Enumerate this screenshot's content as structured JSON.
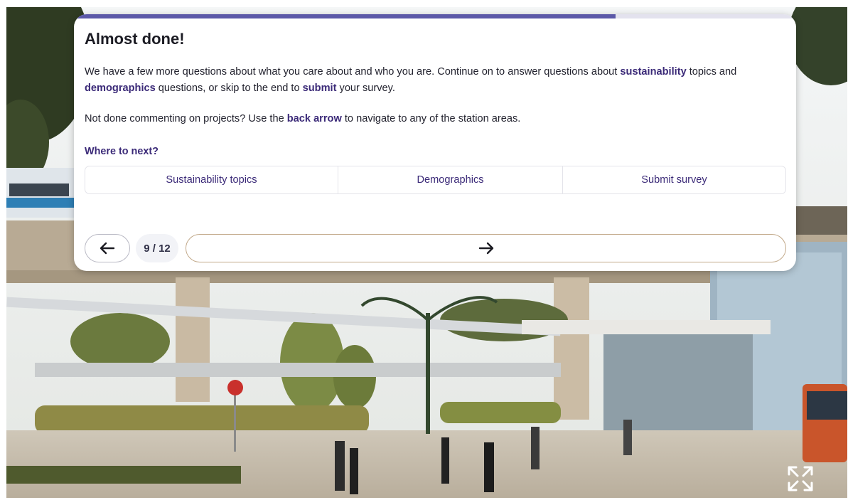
{
  "card": {
    "title": "Almost done!",
    "progress_fraction": 0.75,
    "intro": {
      "t1": "We have a few more questions about what you care about and who you are. Continue on to answer questions about ",
      "k1": "sustainability",
      "t2": " topics and ",
      "k2": "demographics",
      "t3": " questions, or skip to the end to ",
      "k3": "submit",
      "t4": " your survey."
    },
    "back_note": {
      "t1": "Not done commenting on projects? Use the ",
      "k1": "back arrow",
      "t2": " to navigate to any of the station areas."
    },
    "next_heading": "Where to next?",
    "choices": [
      "Sustainability topics",
      "Demographics",
      "Submit survey"
    ],
    "nav": {
      "page_counter": "9 / 12",
      "back_icon": "arrow-left-icon",
      "next_icon": "arrow-right-icon"
    }
  },
  "fullscreen_icon": "fullscreen-expand-icon",
  "colors": {
    "accent": "#3b2a78",
    "progress": "#5b58a8",
    "forward_border": "#c2a98a"
  }
}
